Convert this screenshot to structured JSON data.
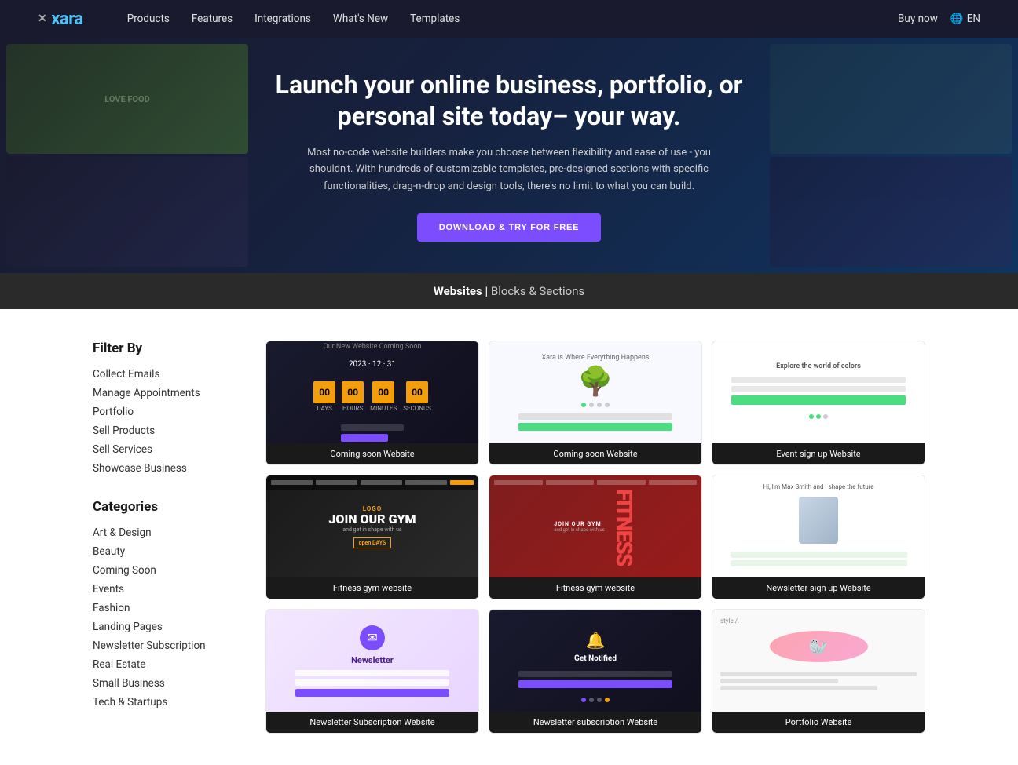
{
  "nav": {
    "logo": "xara",
    "x_mark": "✕",
    "links": [
      {
        "label": "Products",
        "has_arrow": true
      },
      {
        "label": "Features"
      },
      {
        "label": "Integrations"
      },
      {
        "label": "What's New"
      },
      {
        "label": "Templates"
      }
    ],
    "right_links": [
      {
        "label": "Buy now"
      }
    ],
    "lang": "EN"
  },
  "hero": {
    "title": "Launch your online business, portfolio, or personal site today– your way.",
    "subtitle": "Most no-code website builders make you choose between flexibility and ease of use - you shouldn't. With hundreds of customizable templates, pre-designed sections with specific functionalities, drag-n-drop and design tools, there's no limit to what you can build.",
    "cta_label": "DOWNLOAD & TRY FOR FREE"
  },
  "section_divider": {
    "bold": "Websites",
    "separator": " | ",
    "light": "Blocks & Sections"
  },
  "sidebar": {
    "filter_title": "Filter By",
    "filter_links": [
      {
        "label": "Collect Emails",
        "active": false
      },
      {
        "label": "Manage Appointments",
        "active": false
      },
      {
        "label": "Portfolio",
        "active": false
      },
      {
        "label": "Sell Products",
        "active": false
      },
      {
        "label": "Sell Services",
        "active": false
      },
      {
        "label": "Showcase Business",
        "active": false
      }
    ],
    "categories_title": "Categories",
    "category_links": [
      {
        "label": "Art & Design"
      },
      {
        "label": "Beauty"
      },
      {
        "label": "Coming Soon"
      },
      {
        "label": "Events"
      },
      {
        "label": "Fashion"
      },
      {
        "label": "Landing Pages"
      },
      {
        "label": "Newsletter Subscription"
      },
      {
        "label": "Real Estate"
      },
      {
        "label": "Small Business"
      },
      {
        "label": "Tech & Startups"
      }
    ]
  },
  "templates": [
    {
      "label": "Coming soon Website",
      "type": "coming-soon-dark"
    },
    {
      "label": "Coming soon Website",
      "type": "coming-soon-light"
    },
    {
      "label": "Event sign up Website",
      "type": "event-signup"
    },
    {
      "label": "Fitness gym website",
      "type": "gym-dark"
    },
    {
      "label": "Fitness gym website",
      "type": "gym-red"
    },
    {
      "label": "Newsletter sign up Website",
      "type": "newsletter-person"
    },
    {
      "label": "Newsletter Subscription Website",
      "type": "newsletter-purple"
    },
    {
      "label": "Newsletter subscription Website",
      "type": "newsletter-dark"
    },
    {
      "label": "Portfolio Website",
      "type": "portfolio-clean"
    }
  ]
}
